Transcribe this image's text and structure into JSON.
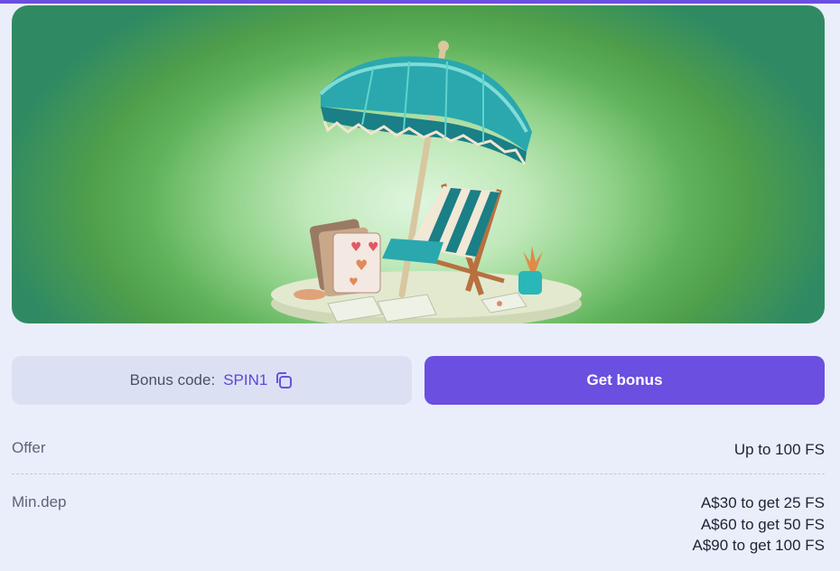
{
  "colors": {
    "accent": "#6b4fe0",
    "code_button_bg": "#dbe1f3",
    "page_bg": "#eaeefb"
  },
  "banner": {
    "image": "beach-umbrella-chair-illustration"
  },
  "bonus_code": {
    "label": "Bonus code:",
    "code": "SPIN1",
    "icon": "copy-icon"
  },
  "get_bonus": {
    "label": "Get bonus"
  },
  "details": {
    "offer": {
      "label": "Offer",
      "value": "Up to 100 FS"
    },
    "min_dep": {
      "label": "Min.dep",
      "values": [
        "A$30 to get 25 FS",
        "A$60 to get 50 FS",
        "A$90 to get 100 FS"
      ]
    }
  }
}
